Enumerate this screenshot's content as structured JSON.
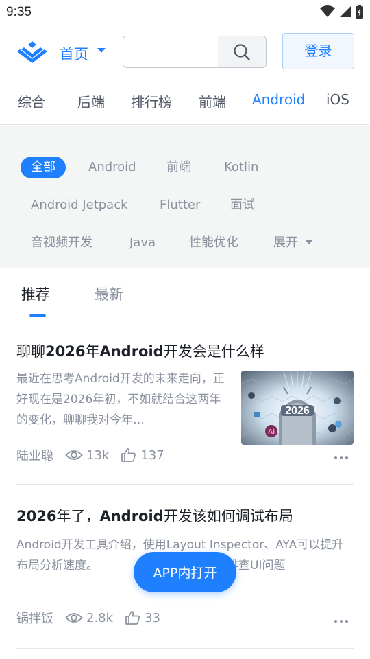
{
  "status_bar": {
    "time": "9:35"
  },
  "header": {
    "home_label": "首页",
    "search": {
      "value": "",
      "placeholder": ""
    },
    "login_label": "登录",
    "brand_color": "#1e80ff"
  },
  "category_tabs": [
    "综合",
    "后端",
    "排行榜",
    "前端",
    "Android",
    "iOS"
  ],
  "active_category": "Android",
  "tags": [
    "全部",
    "Android",
    "前端",
    "Kotlin",
    "Android Jetpack",
    "Flutter",
    "面试",
    "音视频开发",
    "Java",
    "性能优化"
  ],
  "active_tag": "全部",
  "expand_label": "展开",
  "feed_tabs": [
    "推荐",
    "最新"
  ],
  "active_feed_tab": "推荐",
  "articles": [
    {
      "title_parts": [
        "聊聊",
        "2026",
        "年",
        "Android",
        "开发会是什么样"
      ],
      "excerpt": "最近在思考Android开发的未来走向，正好现在是2026年初，不如就结合这两年的变化，聊聊我对今年…",
      "author": "陆业聪",
      "views": "13k",
      "likes": "137",
      "thumbnail_text": "2026",
      "thumbnail_badge": "Ai"
    },
    {
      "title_parts": [
        "2026",
        "年了，",
        "Android",
        "开发该如何调试布局"
      ],
      "excerpt": "Android开发工具介绍，使用Layout Inspector、AYA可以提升布局分析速度。",
      "excerpt_tail": "助排查UI问题",
      "author": "锅拌饭",
      "views": "2.8k",
      "likes": "33"
    }
  ],
  "open_app_label": "APP内打开"
}
